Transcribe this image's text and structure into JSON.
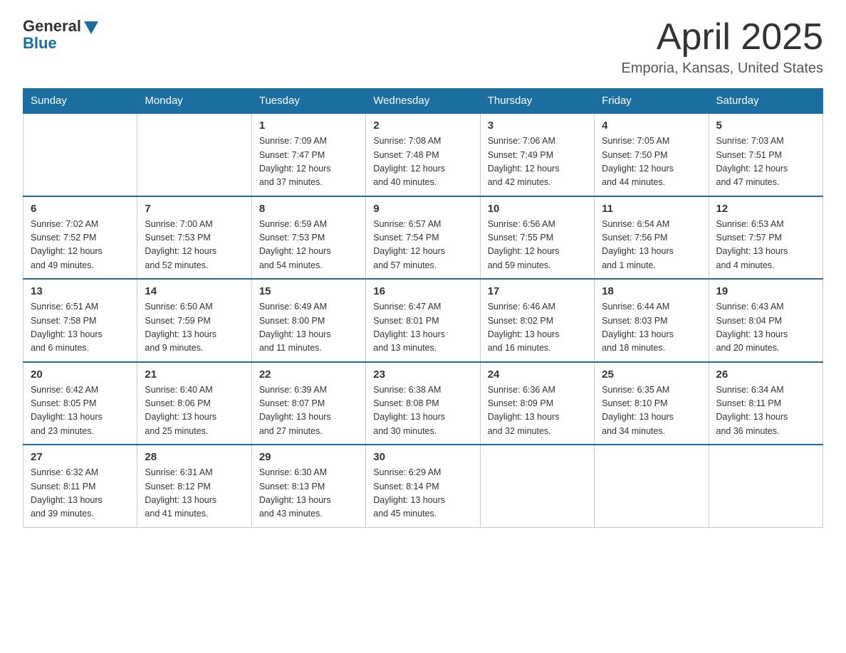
{
  "header": {
    "logo_general": "General",
    "logo_blue": "Blue",
    "month_year": "April 2025",
    "location": "Emporia, Kansas, United States"
  },
  "weekdays": [
    "Sunday",
    "Monday",
    "Tuesday",
    "Wednesday",
    "Thursday",
    "Friday",
    "Saturday"
  ],
  "weeks": [
    [
      {
        "day": "",
        "info": ""
      },
      {
        "day": "",
        "info": ""
      },
      {
        "day": "1",
        "info": "Sunrise: 7:09 AM\nSunset: 7:47 PM\nDaylight: 12 hours\nand 37 minutes."
      },
      {
        "day": "2",
        "info": "Sunrise: 7:08 AM\nSunset: 7:48 PM\nDaylight: 12 hours\nand 40 minutes."
      },
      {
        "day": "3",
        "info": "Sunrise: 7:06 AM\nSunset: 7:49 PM\nDaylight: 12 hours\nand 42 minutes."
      },
      {
        "day": "4",
        "info": "Sunrise: 7:05 AM\nSunset: 7:50 PM\nDaylight: 12 hours\nand 44 minutes."
      },
      {
        "day": "5",
        "info": "Sunrise: 7:03 AM\nSunset: 7:51 PM\nDaylight: 12 hours\nand 47 minutes."
      }
    ],
    [
      {
        "day": "6",
        "info": "Sunrise: 7:02 AM\nSunset: 7:52 PM\nDaylight: 12 hours\nand 49 minutes."
      },
      {
        "day": "7",
        "info": "Sunrise: 7:00 AM\nSunset: 7:53 PM\nDaylight: 12 hours\nand 52 minutes."
      },
      {
        "day": "8",
        "info": "Sunrise: 6:59 AM\nSunset: 7:53 PM\nDaylight: 12 hours\nand 54 minutes."
      },
      {
        "day": "9",
        "info": "Sunrise: 6:57 AM\nSunset: 7:54 PM\nDaylight: 12 hours\nand 57 minutes."
      },
      {
        "day": "10",
        "info": "Sunrise: 6:56 AM\nSunset: 7:55 PM\nDaylight: 12 hours\nand 59 minutes."
      },
      {
        "day": "11",
        "info": "Sunrise: 6:54 AM\nSunset: 7:56 PM\nDaylight: 13 hours\nand 1 minute."
      },
      {
        "day": "12",
        "info": "Sunrise: 6:53 AM\nSunset: 7:57 PM\nDaylight: 13 hours\nand 4 minutes."
      }
    ],
    [
      {
        "day": "13",
        "info": "Sunrise: 6:51 AM\nSunset: 7:58 PM\nDaylight: 13 hours\nand 6 minutes."
      },
      {
        "day": "14",
        "info": "Sunrise: 6:50 AM\nSunset: 7:59 PM\nDaylight: 13 hours\nand 9 minutes."
      },
      {
        "day": "15",
        "info": "Sunrise: 6:49 AM\nSunset: 8:00 PM\nDaylight: 13 hours\nand 11 minutes."
      },
      {
        "day": "16",
        "info": "Sunrise: 6:47 AM\nSunset: 8:01 PM\nDaylight: 13 hours\nand 13 minutes."
      },
      {
        "day": "17",
        "info": "Sunrise: 6:46 AM\nSunset: 8:02 PM\nDaylight: 13 hours\nand 16 minutes."
      },
      {
        "day": "18",
        "info": "Sunrise: 6:44 AM\nSunset: 8:03 PM\nDaylight: 13 hours\nand 18 minutes."
      },
      {
        "day": "19",
        "info": "Sunrise: 6:43 AM\nSunset: 8:04 PM\nDaylight: 13 hours\nand 20 minutes."
      }
    ],
    [
      {
        "day": "20",
        "info": "Sunrise: 6:42 AM\nSunset: 8:05 PM\nDaylight: 13 hours\nand 23 minutes."
      },
      {
        "day": "21",
        "info": "Sunrise: 6:40 AM\nSunset: 8:06 PM\nDaylight: 13 hours\nand 25 minutes."
      },
      {
        "day": "22",
        "info": "Sunrise: 6:39 AM\nSunset: 8:07 PM\nDaylight: 13 hours\nand 27 minutes."
      },
      {
        "day": "23",
        "info": "Sunrise: 6:38 AM\nSunset: 8:08 PM\nDaylight: 13 hours\nand 30 minutes."
      },
      {
        "day": "24",
        "info": "Sunrise: 6:36 AM\nSunset: 8:09 PM\nDaylight: 13 hours\nand 32 minutes."
      },
      {
        "day": "25",
        "info": "Sunrise: 6:35 AM\nSunset: 8:10 PM\nDaylight: 13 hours\nand 34 minutes."
      },
      {
        "day": "26",
        "info": "Sunrise: 6:34 AM\nSunset: 8:11 PM\nDaylight: 13 hours\nand 36 minutes."
      }
    ],
    [
      {
        "day": "27",
        "info": "Sunrise: 6:32 AM\nSunset: 8:11 PM\nDaylight: 13 hours\nand 39 minutes."
      },
      {
        "day": "28",
        "info": "Sunrise: 6:31 AM\nSunset: 8:12 PM\nDaylight: 13 hours\nand 41 minutes."
      },
      {
        "day": "29",
        "info": "Sunrise: 6:30 AM\nSunset: 8:13 PM\nDaylight: 13 hours\nand 43 minutes."
      },
      {
        "day": "30",
        "info": "Sunrise: 6:29 AM\nSunset: 8:14 PM\nDaylight: 13 hours\nand 45 minutes."
      },
      {
        "day": "",
        "info": ""
      },
      {
        "day": "",
        "info": ""
      },
      {
        "day": "",
        "info": ""
      }
    ]
  ]
}
